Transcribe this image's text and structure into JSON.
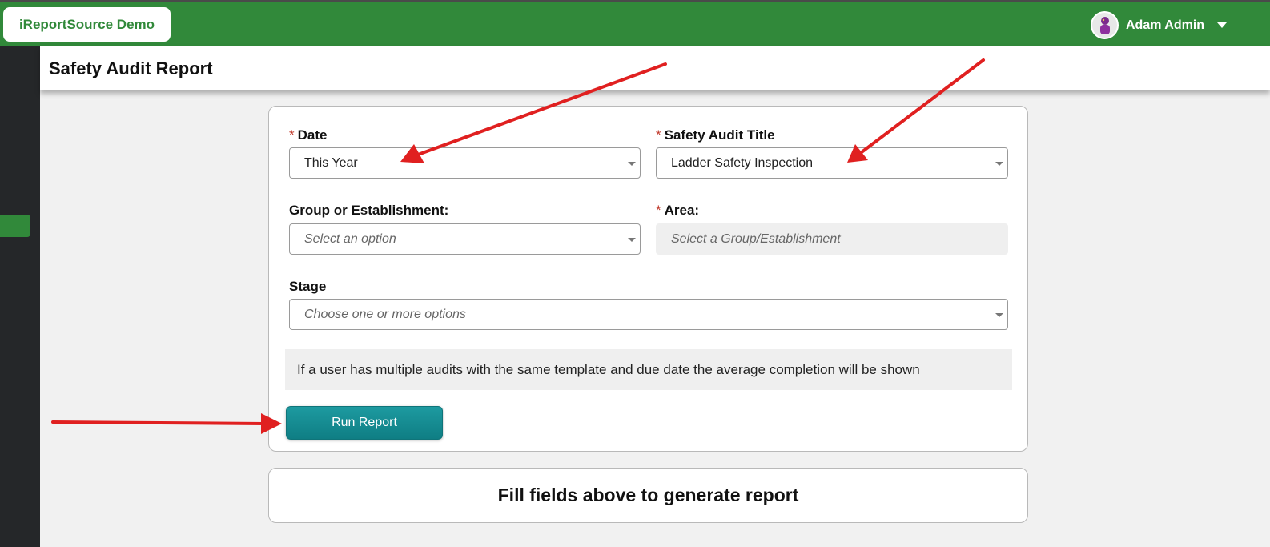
{
  "app": {
    "brand": "iReportSource Demo",
    "user_name": "Adam Admin",
    "colors": {
      "topbar": "#31893a",
      "sidebar": "#252729",
      "button": "#138a90",
      "annotation": "#e02020"
    }
  },
  "page": {
    "title": "Safety Audit Report"
  },
  "form": {
    "date": {
      "label": "Date",
      "required_mark": "*",
      "value": "This Year"
    },
    "audit_title": {
      "label": "Safety Audit Title",
      "required_mark": "*",
      "value": "Ladder Safety Inspection"
    },
    "group": {
      "label": "Group or Establishment:",
      "placeholder": "Select an option"
    },
    "area": {
      "label": "Area:",
      "required_mark": "*",
      "placeholder": "Select a Group/Establishment"
    },
    "stage": {
      "label": "Stage",
      "placeholder": "Choose one or more options"
    },
    "note": "If a user has multiple audits with the same template and due date the average completion will be shown",
    "run_button": "Run Report"
  },
  "result": {
    "message": "Fill fields above to generate report"
  }
}
